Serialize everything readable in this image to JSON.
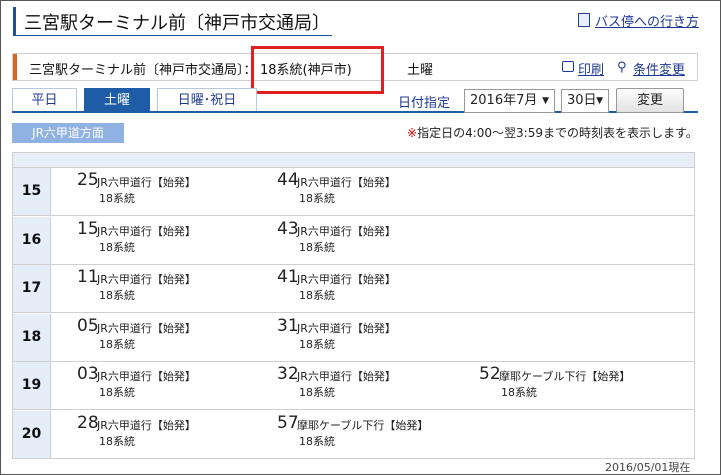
{
  "header": {
    "page_title": "三宮駅ターミナル前〔神戸市交通局〕",
    "howto_link": "バス停への行き方"
  },
  "info": {
    "stop": "三宮駅ターミナル前〔神戸市交通局〕：",
    "route": "18系統(神戸市)",
    "day": "土曜",
    "print_label": "印刷",
    "conditions_label": "条件変更"
  },
  "tabs": [
    {
      "label": "平日",
      "selected": false
    },
    {
      "label": "土曜",
      "selected": true
    },
    {
      "label": "日曜･祝日",
      "selected": false
    }
  ],
  "date_filter": {
    "label": "日付指定",
    "month": "2016年7月",
    "day": "30日",
    "change_button": "変更"
  },
  "direction": "JR六甲道方面",
  "notice": {
    "mark": "※",
    "text": "指定日の4:00～翌3:59までの時刻表を表示します。"
  },
  "timetable": [
    {
      "hour": "15",
      "departures": [
        {
          "minute": "25",
          "dest": "JR六甲道行【始発】",
          "route": "18系統"
        },
        {
          "minute": "44",
          "dest": "JR六甲道行【始発】",
          "route": "18系統"
        }
      ]
    },
    {
      "hour": "16",
      "departures": [
        {
          "minute": "15",
          "dest": "JR六甲道行【始発】",
          "route": "18系統"
        },
        {
          "minute": "43",
          "dest": "JR六甲道行【始発】",
          "route": "18系統"
        }
      ]
    },
    {
      "hour": "17",
      "departures": [
        {
          "minute": "11",
          "dest": "JR六甲道行【始発】",
          "route": "18系統"
        },
        {
          "minute": "41",
          "dest": "JR六甲道行【始発】",
          "route": "18系統"
        }
      ]
    },
    {
      "hour": "18",
      "departures": [
        {
          "minute": "05",
          "dest": "JR六甲道行【始発】",
          "route": "18系統"
        },
        {
          "minute": "31",
          "dest": "JR六甲道行【始発】",
          "route": "18系統"
        }
      ]
    },
    {
      "hour": "19",
      "departures": [
        {
          "minute": "03",
          "dest": "JR六甲道行【始発】",
          "route": "18系統"
        },
        {
          "minute": "32",
          "dest": "JR六甲道行【始発】",
          "route": "18系統"
        },
        {
          "minute": "52",
          "dest": "摩耶ケーブル下行【始発】",
          "route": "18系統"
        }
      ]
    },
    {
      "hour": "20",
      "departures": [
        {
          "minute": "28",
          "dest": "JR六甲道行【始発】",
          "route": "18系統"
        },
        {
          "minute": "57",
          "dest": "摩耶ケーブル下行【始発】",
          "route": "18系統"
        }
      ]
    }
  ],
  "as_of": "2016/05/01現在",
  "colors": {
    "accent_blue": "#1f5ca8",
    "highlight_red": "#e02020",
    "info_accent": "#e2631b"
  }
}
